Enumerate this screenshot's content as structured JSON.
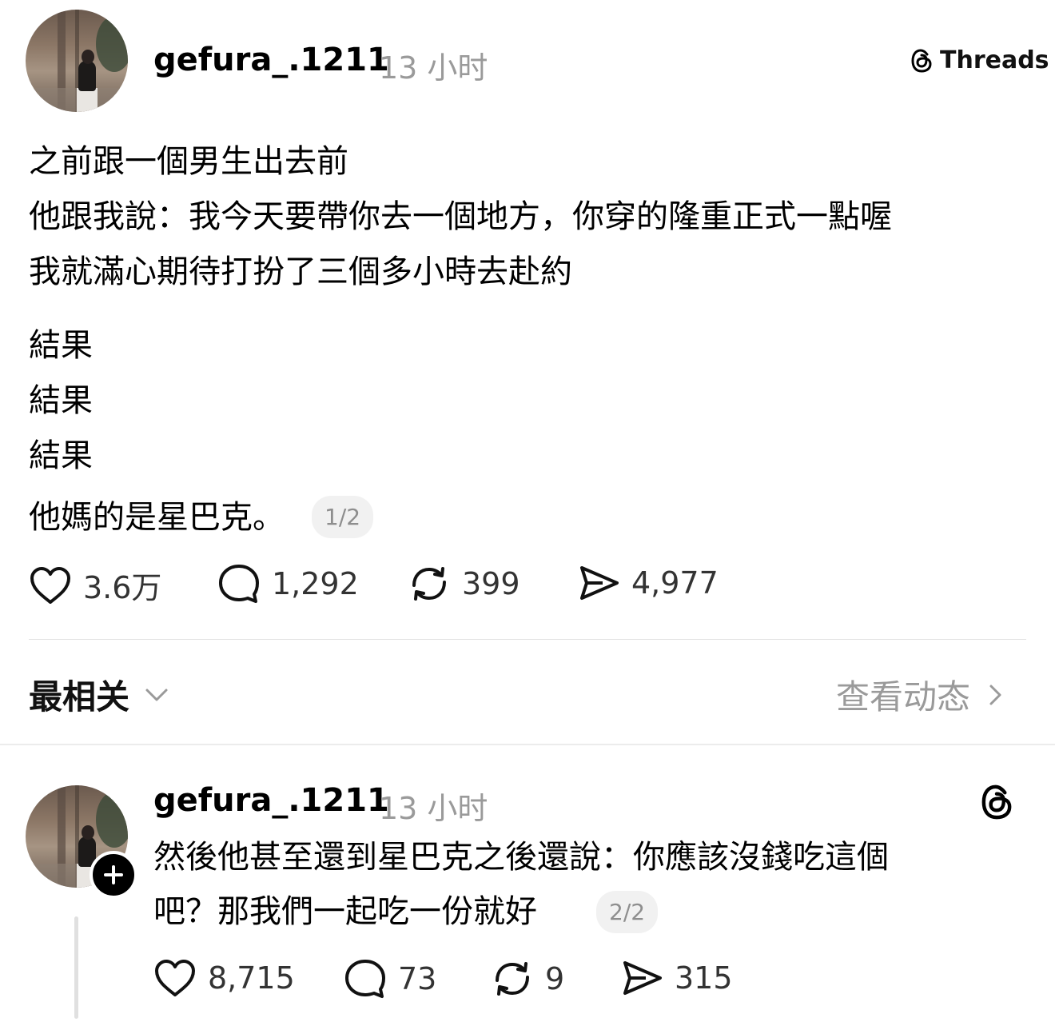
{
  "post": {
    "username": "gefura_.1211",
    "time": "13 小时",
    "brand_label": "Threads",
    "lines": [
      "之前跟一個男生出去前",
      "他跟我說：我今天要帶你去一個地方，你穿的隆重正式一點喔",
      "我就滿心期待打扮了三個多小時去赴約",
      "結果",
      "結果",
      "結果",
      "他媽的是星巴克。"
    ],
    "pager": "1/2",
    "likes": "3.6万",
    "comments": "1,292",
    "reposts": "399",
    "shares": "4,977"
  },
  "sort": {
    "label": "最相关",
    "activity_label": "查看动态"
  },
  "reply": {
    "username": "gefura_.1211",
    "time": "13 小时",
    "lines": [
      "然後他甚至還到星巴克之後還說：你應該沒錢吃這個",
      "吧？那我們一起吃一份就好"
    ],
    "pager": "2/2",
    "likes": "8,715",
    "comments": "73",
    "reposts": "9",
    "shares": "315"
  },
  "icons": {
    "like": "heart-icon",
    "comment": "comment-bubble-icon",
    "repost": "repost-icon",
    "share": "send-icon",
    "threads": "threads-logo-icon",
    "chevron_down": "chevron-down-icon",
    "chevron_right": "chevron-right-icon",
    "follow": "plus-icon"
  },
  "colors": {
    "text": "#000000",
    "muted": "#9a9a9a",
    "divider": "#e2e2e2"
  }
}
